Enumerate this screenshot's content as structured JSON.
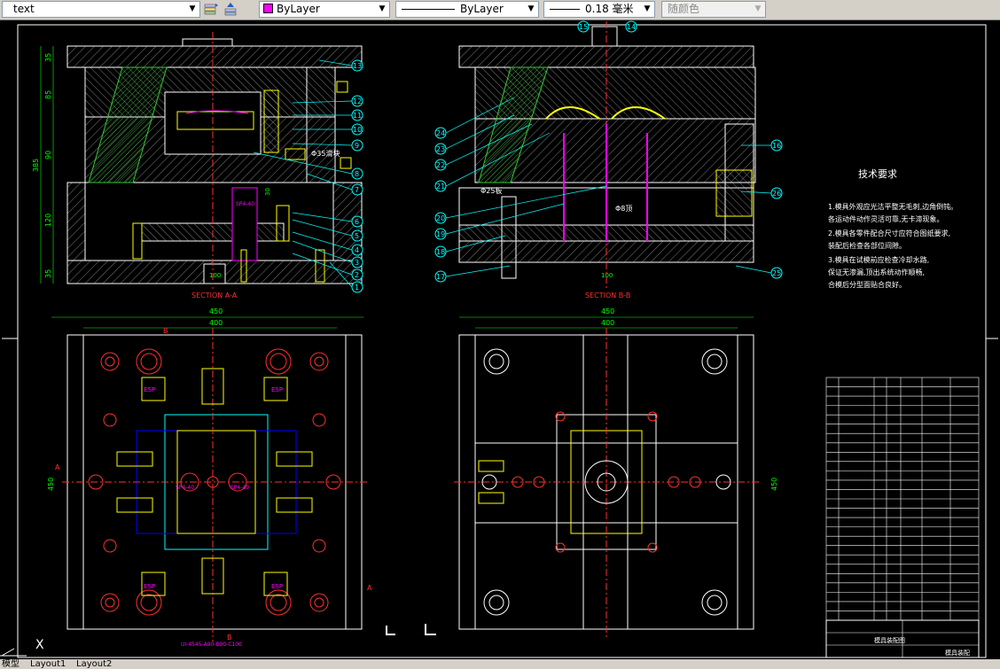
{
  "toolbar": {
    "text_style": "text",
    "color": "ByLayer",
    "color_swatch": "#ff00ff",
    "linetype": "ByLayer",
    "lineweight": "0.18 毫米",
    "plot_style": "随颜色",
    "icons": [
      "layer-states-icon",
      "layer-previous-icon"
    ]
  },
  "drawing": {
    "background": "#000000",
    "section_aa": "SECTION A-A",
    "section_bb": "SECTION B-B",
    "dims_left_vertical": [
      "35",
      "85",
      "90",
      "120",
      "35"
    ],
    "dim_total_height": "385",
    "dims_mid_vertical": [
      "30"
    ],
    "dim_width_outer": "450",
    "dim_width_inner": "400",
    "dim_plate_height": "450",
    "dim_plate_height_right": "450",
    "support_width": "100",
    "diameter_labels": [
      "Φ35滑块",
      "Φ25板",
      "Φ8顶"
    ],
    "label_spf_top": "SP4-40",
    "label_spf_mid": [
      "SP4-40",
      "SP4-40"
    ],
    "label_esp": [
      "ESP",
      "ESP",
      "ESP",
      "ESP"
    ],
    "label_bottom": "UI-4545-A90-B90-C100",
    "section_marks": [
      "A",
      "A",
      "B",
      "B"
    ],
    "balloons_aa": [
      "13",
      "12",
      "11",
      "10",
      "9",
      "8",
      "7",
      "6",
      "5",
      "4",
      "3",
      "2",
      "1"
    ],
    "balloons_bb": [
      "24",
      "23",
      "22",
      "21",
      "20",
      "19",
      "18",
      "17",
      "16",
      "26",
      "25",
      "15",
      "14"
    ],
    "tech_title": "技术要求",
    "tech_notes": [
      "1.模具外观应光洁平整无毛刺,边角倒钝。",
      "各运动件动作灵活可靠,无卡滞现象。",
      "2.模具各零件配合尺寸应符合图纸要求,",
      "装配后检查各部位间隙。",
      "3.模具在试模前应检查冷却水路,",
      "保证无渗漏,顶出系统动作顺畅,",
      "合模后分型面贴合良好。"
    ]
  },
  "title_block": {
    "rows": 26,
    "columns": 7,
    "drawing_name": "模具装配图",
    "company": "模具装配"
  },
  "ucs": {
    "label": "X"
  },
  "layout_tabs": [
    "模型",
    "Layout1",
    "Layout2"
  ]
}
